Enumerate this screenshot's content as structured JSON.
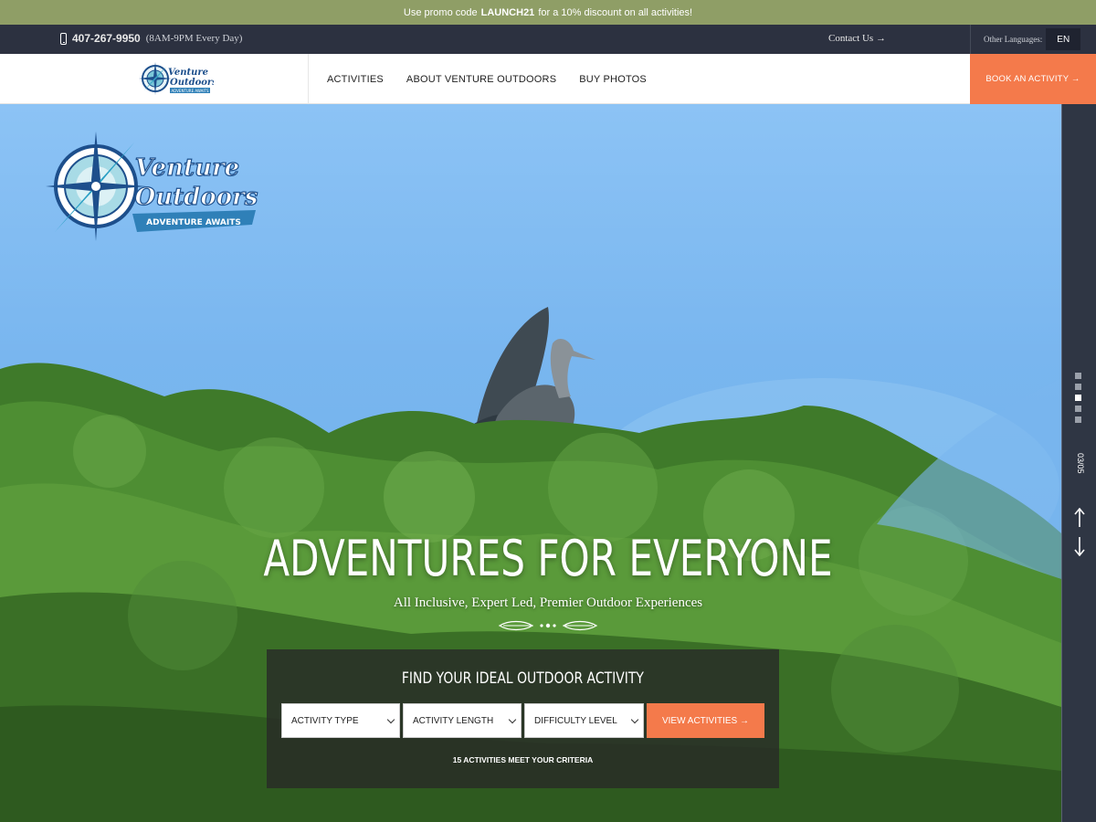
{
  "promo": {
    "prefix": "Use promo code",
    "code": "LAUNCH21",
    "suffix": "for a 10% discount on all activities!"
  },
  "utility": {
    "phone": "407-267-9950",
    "hours": "(8AM-9PM Every Day)",
    "contact": "Contact Us →",
    "languages_label": "Other Languages:",
    "language": "EN"
  },
  "nav": {
    "logo_alt": "Venture Outdoors",
    "items": [
      "ACTIVITIES",
      "ABOUT VENTURE OUTDOORS",
      "BUY PHOTOS"
    ],
    "book": "BOOK AN ACTIVITY →"
  },
  "logo": {
    "line1": "Venture",
    "line2": "Outdoors",
    "tagline": "ADVENTURE AWAITS",
    "small_tagline": "ADVENTURE AWAITS"
  },
  "hero": {
    "title": "ADVENTURES FOR EVERYONE",
    "subtitle": "All Inclusive, Expert Led, Premier Outdoor Experiences"
  },
  "finder": {
    "title": "FIND YOUR IDEAL OUTDOOR ACTIVITY",
    "selects": [
      "ACTIVITY TYPE",
      "ACTIVITY LENGTH",
      "DIFFICULTY LEVEL"
    ],
    "button": "VIEW ACTIVITIES →",
    "criteria": "15 ACTIVITIES MEET YOUR CRITERIA"
  },
  "slider": {
    "counter": "03/05",
    "total": 5,
    "active_index": 3
  },
  "colors": {
    "accent": "#f47a4b",
    "promo_bg": "#8f9e66",
    "dark_bar": "#2c3140",
    "rail": "#2f3644"
  },
  "icons": [
    "phone-icon",
    "arrow-up-icon",
    "arrow-down-icon",
    "chevron-down-icon",
    "ornament-divider"
  ]
}
